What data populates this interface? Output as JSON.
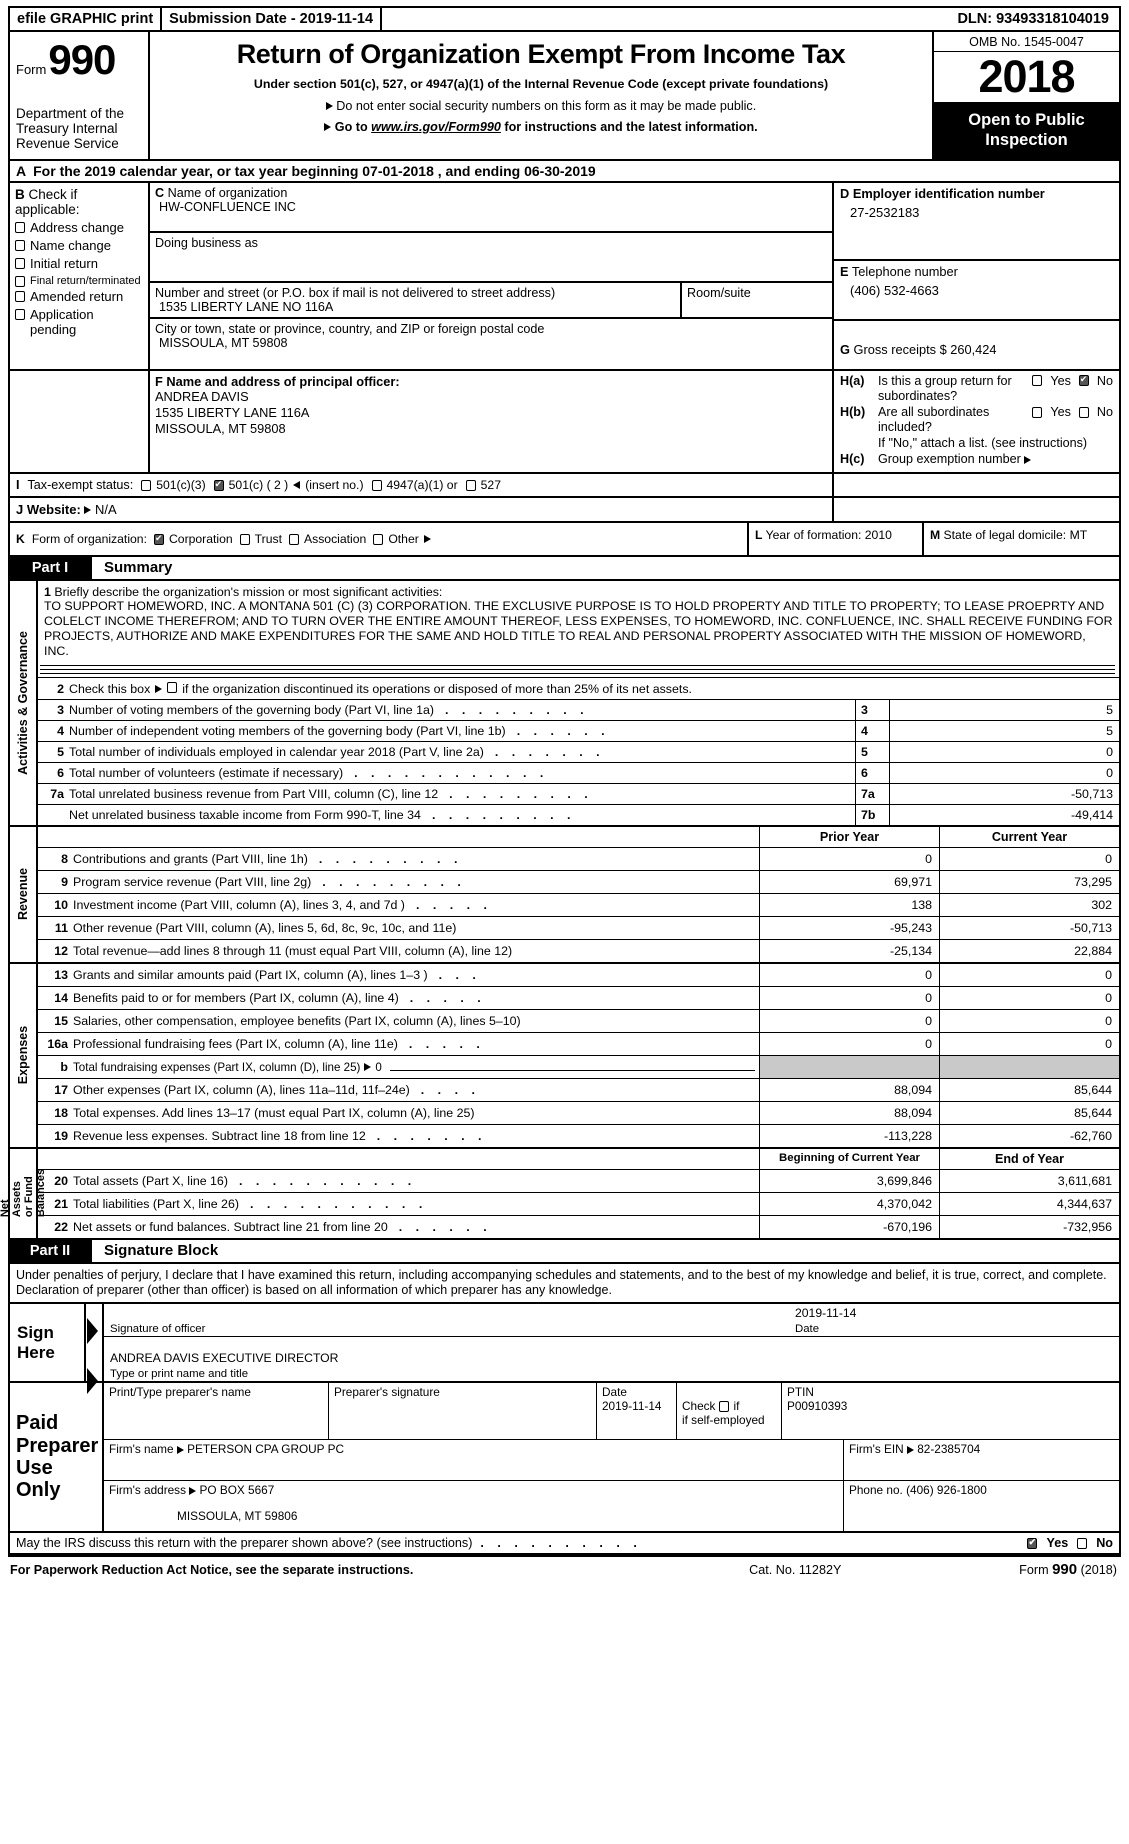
{
  "efile": {
    "graphic_print": "efile GRAPHIC print",
    "submission_date": "Submission Date - 2019-11-14",
    "dln": "DLN: 93493318104019"
  },
  "header": {
    "form_word": "Form",
    "form_number": "990",
    "department": "Department of the Treasury Internal Revenue Service",
    "title": "Return of Organization Exempt From Income Tax",
    "subtitle": "Under section 501(c), 527, or 4947(a)(1) of the Internal Revenue Code (except private foundations)",
    "note_ssn": "Do not enter social security numbers on this form as it may be made public.",
    "note_goto_prefix": "Go to",
    "note_goto_link": "www.irs.gov/Form990",
    "note_goto_suffix": "for instructions and the latest information.",
    "omb": "OMB No. 1545-0047",
    "year": "2018",
    "open_to_public": "Open to Public Inspection"
  },
  "line_a": {
    "letter": "A",
    "text": "For the 2019 calendar year, or tax year beginning 07-01-2018    , and ending 06-30-2019"
  },
  "section_b": {
    "letter": "B",
    "heading": "Check if applicable:",
    "items": [
      {
        "label": "Address change",
        "checked": false
      },
      {
        "label": "Name change",
        "checked": false
      },
      {
        "label": "Initial return",
        "checked": false
      },
      {
        "label": "Final return/terminated",
        "checked": false
      },
      {
        "label": "Amended return",
        "checked": false
      },
      {
        "label": "Application pending",
        "checked": false
      }
    ]
  },
  "section_c": {
    "letter": "C",
    "name_label": "Name of organization",
    "name_value": "HW-CONFLUENCE INC",
    "dba_label": "Doing business as",
    "dba_value": "",
    "street_label": "Number and street (or P.O. box if mail is not delivered to street address)",
    "street_value": "1535 LIBERTY LANE NO 116A",
    "room_label": "Room/suite",
    "room_value": "",
    "city_label": "City or town, state or province, country, and ZIP or foreign postal code",
    "city_value": "MISSOULA, MT  59808"
  },
  "section_d": {
    "letter": "D",
    "label": "Employer identification number",
    "value": "27-2532183"
  },
  "section_e": {
    "letter": "E",
    "label": "Telephone number",
    "value": "(406) 532-4663"
  },
  "section_g": {
    "letter": "G",
    "label": "Gross receipts $",
    "value": "260,424"
  },
  "section_f": {
    "letter": "F",
    "label": "Name and address of principal officer:",
    "officer_name": "ANDREA DAVIS",
    "officer_street": "1535 LIBERTY LANE 116A",
    "officer_city": "MISSOULA, MT  59808"
  },
  "section_h": {
    "ha_key": "H(a)",
    "ha_text": "Is this a group return for subordinates?",
    "ha_yes": "Yes",
    "ha_no": "No",
    "ha_yes_checked": false,
    "ha_no_checked": true,
    "hb_key": "H(b)",
    "hb_text": "Are all subordinates included?",
    "hb_yes": "Yes",
    "hb_no": "No",
    "hb_yes_checked": false,
    "hb_no_checked": false,
    "hb_note": "If \"No,\" attach a list. (see instructions)",
    "hc_key": "H(c)",
    "hc_text": "Group exemption number",
    "hc_value": ""
  },
  "section_i": {
    "letter": "I",
    "label": "Tax-exempt status:",
    "options": [
      {
        "label": "501(c)(3)",
        "checked": false
      },
      {
        "label": "501(c) ( 2 )",
        "checked": true,
        "suffix": "(insert no.)"
      },
      {
        "label": "4947(a)(1) or",
        "checked": false
      },
      {
        "label": "527",
        "checked": false
      }
    ]
  },
  "section_j": {
    "letter": "J",
    "label": "Website:",
    "value": "N/A"
  },
  "section_k": {
    "letter": "K",
    "label": "Form of organization:",
    "options": [
      {
        "label": "Corporation",
        "checked": true
      },
      {
        "label": "Trust",
        "checked": false
      },
      {
        "label": "Association",
        "checked": false
      },
      {
        "label": "Other",
        "checked": false
      }
    ]
  },
  "section_l": {
    "letter": "L",
    "label": "Year of formation:",
    "value": "2010"
  },
  "section_m": {
    "letter": "M",
    "label": "State of legal domicile:",
    "value": "MT"
  },
  "part1": {
    "part_label": "Part I",
    "title": "Summary",
    "vlabels": {
      "governance": "Activities & Governance",
      "revenue": "Revenue",
      "expenses": "Expenses",
      "netassets": "Net Assets or Fund Balances"
    },
    "line1_num": "1",
    "line1_label": "Briefly describe the organization's mission or most significant activities:",
    "mission_text": "TO SUPPORT HOMEWORD, INC. A MONTANA 501 (C) (3) CORPORATION. THE EXCLUSIVE PURPOSE IS TO HOLD PROPERTY AND TITLE TO PROPERTY; TO LEASE PROEPRTY AND COLELCT INCOME THEREFROM; AND TO TURN OVER THE ENTIRE AMOUNT THEREOF, LESS EXPENSES, TO HOMEWORD, INC. CONFLUENCE, INC. SHALL RECEIVE FUNDING FOR PROJECTS, AUTHORIZE AND MAKE EXPENDITURES FOR THE SAME AND HOLD TITLE TO REAL AND PERSONAL PROPERTY ASSOCIATED WITH THE MISSION OF HOMEWORD, INC.",
    "line2_num": "2",
    "line2_text": "Check this box",
    "line2_text2": "if the organization discontinued its operations or disposed of more than 25% of its net assets.",
    "line2_checked": false,
    "gov_rows": [
      {
        "num": "3",
        "text": "Number of voting members of the governing body (Part VI, line 1a)",
        "box": "3",
        "value": "5"
      },
      {
        "num": "4",
        "text": "Number of independent voting members of the governing body (Part VI, line 1b)",
        "box": "4",
        "value": "5"
      },
      {
        "num": "5",
        "text": "Total number of individuals employed in calendar year 2018 (Part V, line 2a)",
        "box": "5",
        "value": "0"
      },
      {
        "num": "6",
        "text": "Total number of volunteers (estimate if necessary)",
        "box": "6",
        "value": "0"
      },
      {
        "num": "7a",
        "text": "Total unrelated business revenue from Part VIII, column (C), line 12",
        "box": "7a",
        "value": "-50,713"
      },
      {
        "num": "",
        "text": "Net unrelated business taxable income from Form 990-T, line 34",
        "box": "7b",
        "value": "-49,414"
      }
    ],
    "col_prior": "Prior Year",
    "col_current": "Current Year",
    "revenue_rows": [
      {
        "num": "8",
        "text": "Contributions and grants (Part VIII, line 1h)",
        "prior": "0",
        "current": "0"
      },
      {
        "num": "9",
        "text": "Program service revenue (Part VIII, line 2g)",
        "prior": "69,971",
        "current": "73,295"
      },
      {
        "num": "10",
        "text": "Investment income (Part VIII, column (A), lines 3, 4, and 7d )",
        "prior": "138",
        "current": "302"
      },
      {
        "num": "11",
        "text": "Other revenue (Part VIII, column (A), lines 5, 6d, 8c, 9c, 10c, and 11e)",
        "prior": "-95,243",
        "current": "-50,713"
      },
      {
        "num": "12",
        "text": "Total revenue—add lines 8 through 11 (must equal Part VIII, column (A), line 12)",
        "prior": "-25,134",
        "current": "22,884"
      }
    ],
    "expense_rows": [
      {
        "num": "13",
        "text": "Grants and similar amounts paid (Part IX, column (A), lines 1–3 )",
        "prior": "0",
        "current": "0"
      },
      {
        "num": "14",
        "text": "Benefits paid to or for members (Part IX, column (A), line 4)",
        "prior": "0",
        "current": "0"
      },
      {
        "num": "15",
        "text": "Salaries, other compensation, employee benefits (Part IX, column (A), lines 5–10)",
        "prior": "0",
        "current": "0"
      },
      {
        "num": "16a",
        "text": "Professional fundraising fees (Part IX, column (A), line 11e)",
        "prior": "0",
        "current": "0"
      }
    ],
    "line16b_num": "b",
    "line16b_text": "Total fundraising expenses (Part IX, column (D), line 25)",
    "line16b_value": "0",
    "expense_rows2": [
      {
        "num": "17",
        "text": "Other expenses (Part IX, column (A), lines 11a–11d, 11f–24e)",
        "prior": "88,094",
        "current": "85,644"
      },
      {
        "num": "18",
        "text": "Total expenses. Add lines 13–17 (must equal Part IX, column (A), line 25)",
        "prior": "88,094",
        "current": "85,644"
      },
      {
        "num": "19",
        "text": "Revenue less expenses. Subtract line 18 from line 12",
        "prior": "-113,228",
        "current": "-62,760"
      }
    ],
    "col_begin": "Beginning of Current Year",
    "col_end": "End of Year",
    "asset_rows": [
      {
        "num": "20",
        "text": "Total assets (Part X, line 16)",
        "begin": "3,699,846",
        "end": "3,611,681"
      },
      {
        "num": "21",
        "text": "Total liabilities (Part X, line 26)",
        "begin": "4,370,042",
        "end": "4,344,637"
      },
      {
        "num": "22",
        "text": "Net assets or fund balances. Subtract line 21 from line 20",
        "begin": "-670,196",
        "end": "-732,956"
      }
    ]
  },
  "part2": {
    "part_label": "Part II",
    "title": "Signature Block",
    "declaration": "Under penalties of perjury, I declare that I have examined this return, including accompanying schedules and statements, and to the best of my knowledge and belief, it is true, correct, and complete. Declaration of preparer (other than officer) is based on all information of which preparer has any knowledge.",
    "sign_here_1": "Sign",
    "sign_here_2": "Here",
    "officer_sig_value": "",
    "officer_sig_caption": "Signature of officer",
    "officer_date_value": "2019-11-14",
    "officer_date_caption": "Date",
    "officer_name_value": "ANDREA DAVIS  EXECUTIVE DIRECTOR",
    "officer_name_caption": "Type or print name and title"
  },
  "preparer": {
    "side_1": "Paid",
    "side_2": "Preparer",
    "side_3": "Use Only",
    "name_label": "Print/Type preparer's name",
    "name_value": "",
    "sig_label": "Preparer's signature",
    "sig_value": "",
    "date_label": "Date",
    "date_value": "2019-11-14",
    "check_label_1": "Check",
    "check_label_2": "if self-employed",
    "check_checked": false,
    "ptin_label": "PTIN",
    "ptin_value": "P00910393",
    "firm_name_label": "Firm's name",
    "firm_name_value": "PETERSON CPA GROUP PC",
    "firm_ein_label": "Firm's EIN",
    "firm_ein_value": "82-2385704",
    "firm_addr_label": "Firm's address",
    "firm_addr_value": "PO BOX 5667",
    "firm_addr_value2": "MISSOULA, MT  59806",
    "phone_label": "Phone no.",
    "phone_value": "(406) 926-1800"
  },
  "irs_discuss": {
    "question": "May the IRS discuss this return with the preparer shown above? (see instructions)",
    "yes": "Yes",
    "no": "No",
    "yes_checked": true,
    "no_checked": false
  },
  "footer": {
    "paperwork": "For Paperwork Reduction Act Notice, see the separate instructions.",
    "cat": "Cat. No. 11282Y",
    "form_prefix": "Form",
    "form_number": "990",
    "form_year": "(2018)"
  }
}
